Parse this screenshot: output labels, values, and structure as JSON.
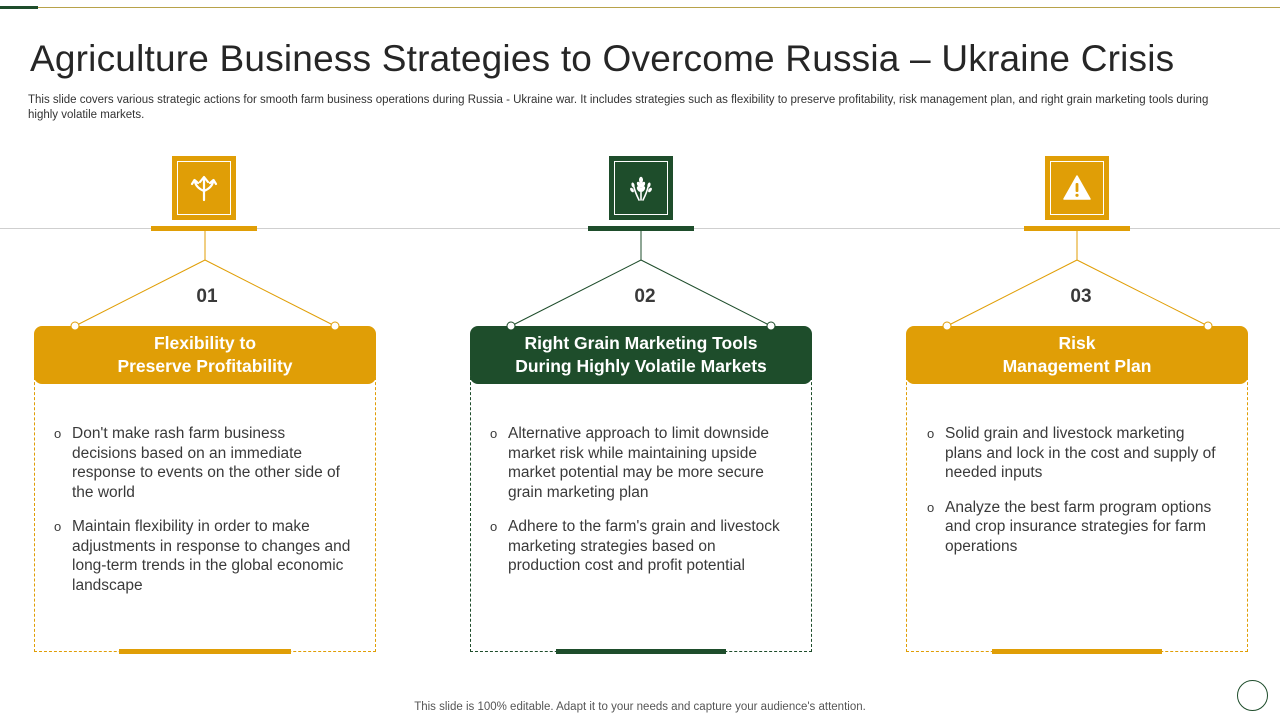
{
  "slide": {
    "title": "Agriculture Business Strategies to Overcome Russia – Ukraine Crisis",
    "subtitle": "This slide covers various strategic actions for smooth farm business operations during Russia - Ukraine war. It includes strategies such as flexibility to preserve profitability, risk management plan, and right grain marketing tools during highly volatile markets.",
    "footer": "This slide is 100% editable. Adapt it to your needs and capture your audience's attention."
  },
  "colors": {
    "gold": "#e09e06",
    "green": "#1e4d2b"
  },
  "cards": [
    {
      "number": "01",
      "icon": "split-arrows-icon",
      "heading_line1": "Flexibility to",
      "heading_line2": "Preserve Profitability",
      "bullets": [
        "Don't make rash farm business decisions based on an immediate response to events on the other side of the world",
        "Maintain flexibility in order to make adjustments in response to changes and long-term trends in the global economic landscape"
      ]
    },
    {
      "number": "02",
      "icon": "wheat-icon",
      "heading_line1": "Right Grain Marketing Tools",
      "heading_line2": "During Highly Volatile Markets",
      "bullets": [
        "Alternative approach to limit downside market risk while maintaining upside market potential may be more secure grain marketing plan",
        "Adhere to the farm's grain and livestock marketing strategies based on production cost and profit potential"
      ]
    },
    {
      "number": "03",
      "icon": "warning-icon",
      "heading_line1": "Risk",
      "heading_line2": "Management Plan",
      "bullets": [
        "Solid grain and livestock marketing plans and lock in the cost and supply of needed inputs",
        "Analyze the best farm program options and crop insurance strategies for farm operations"
      ]
    }
  ]
}
